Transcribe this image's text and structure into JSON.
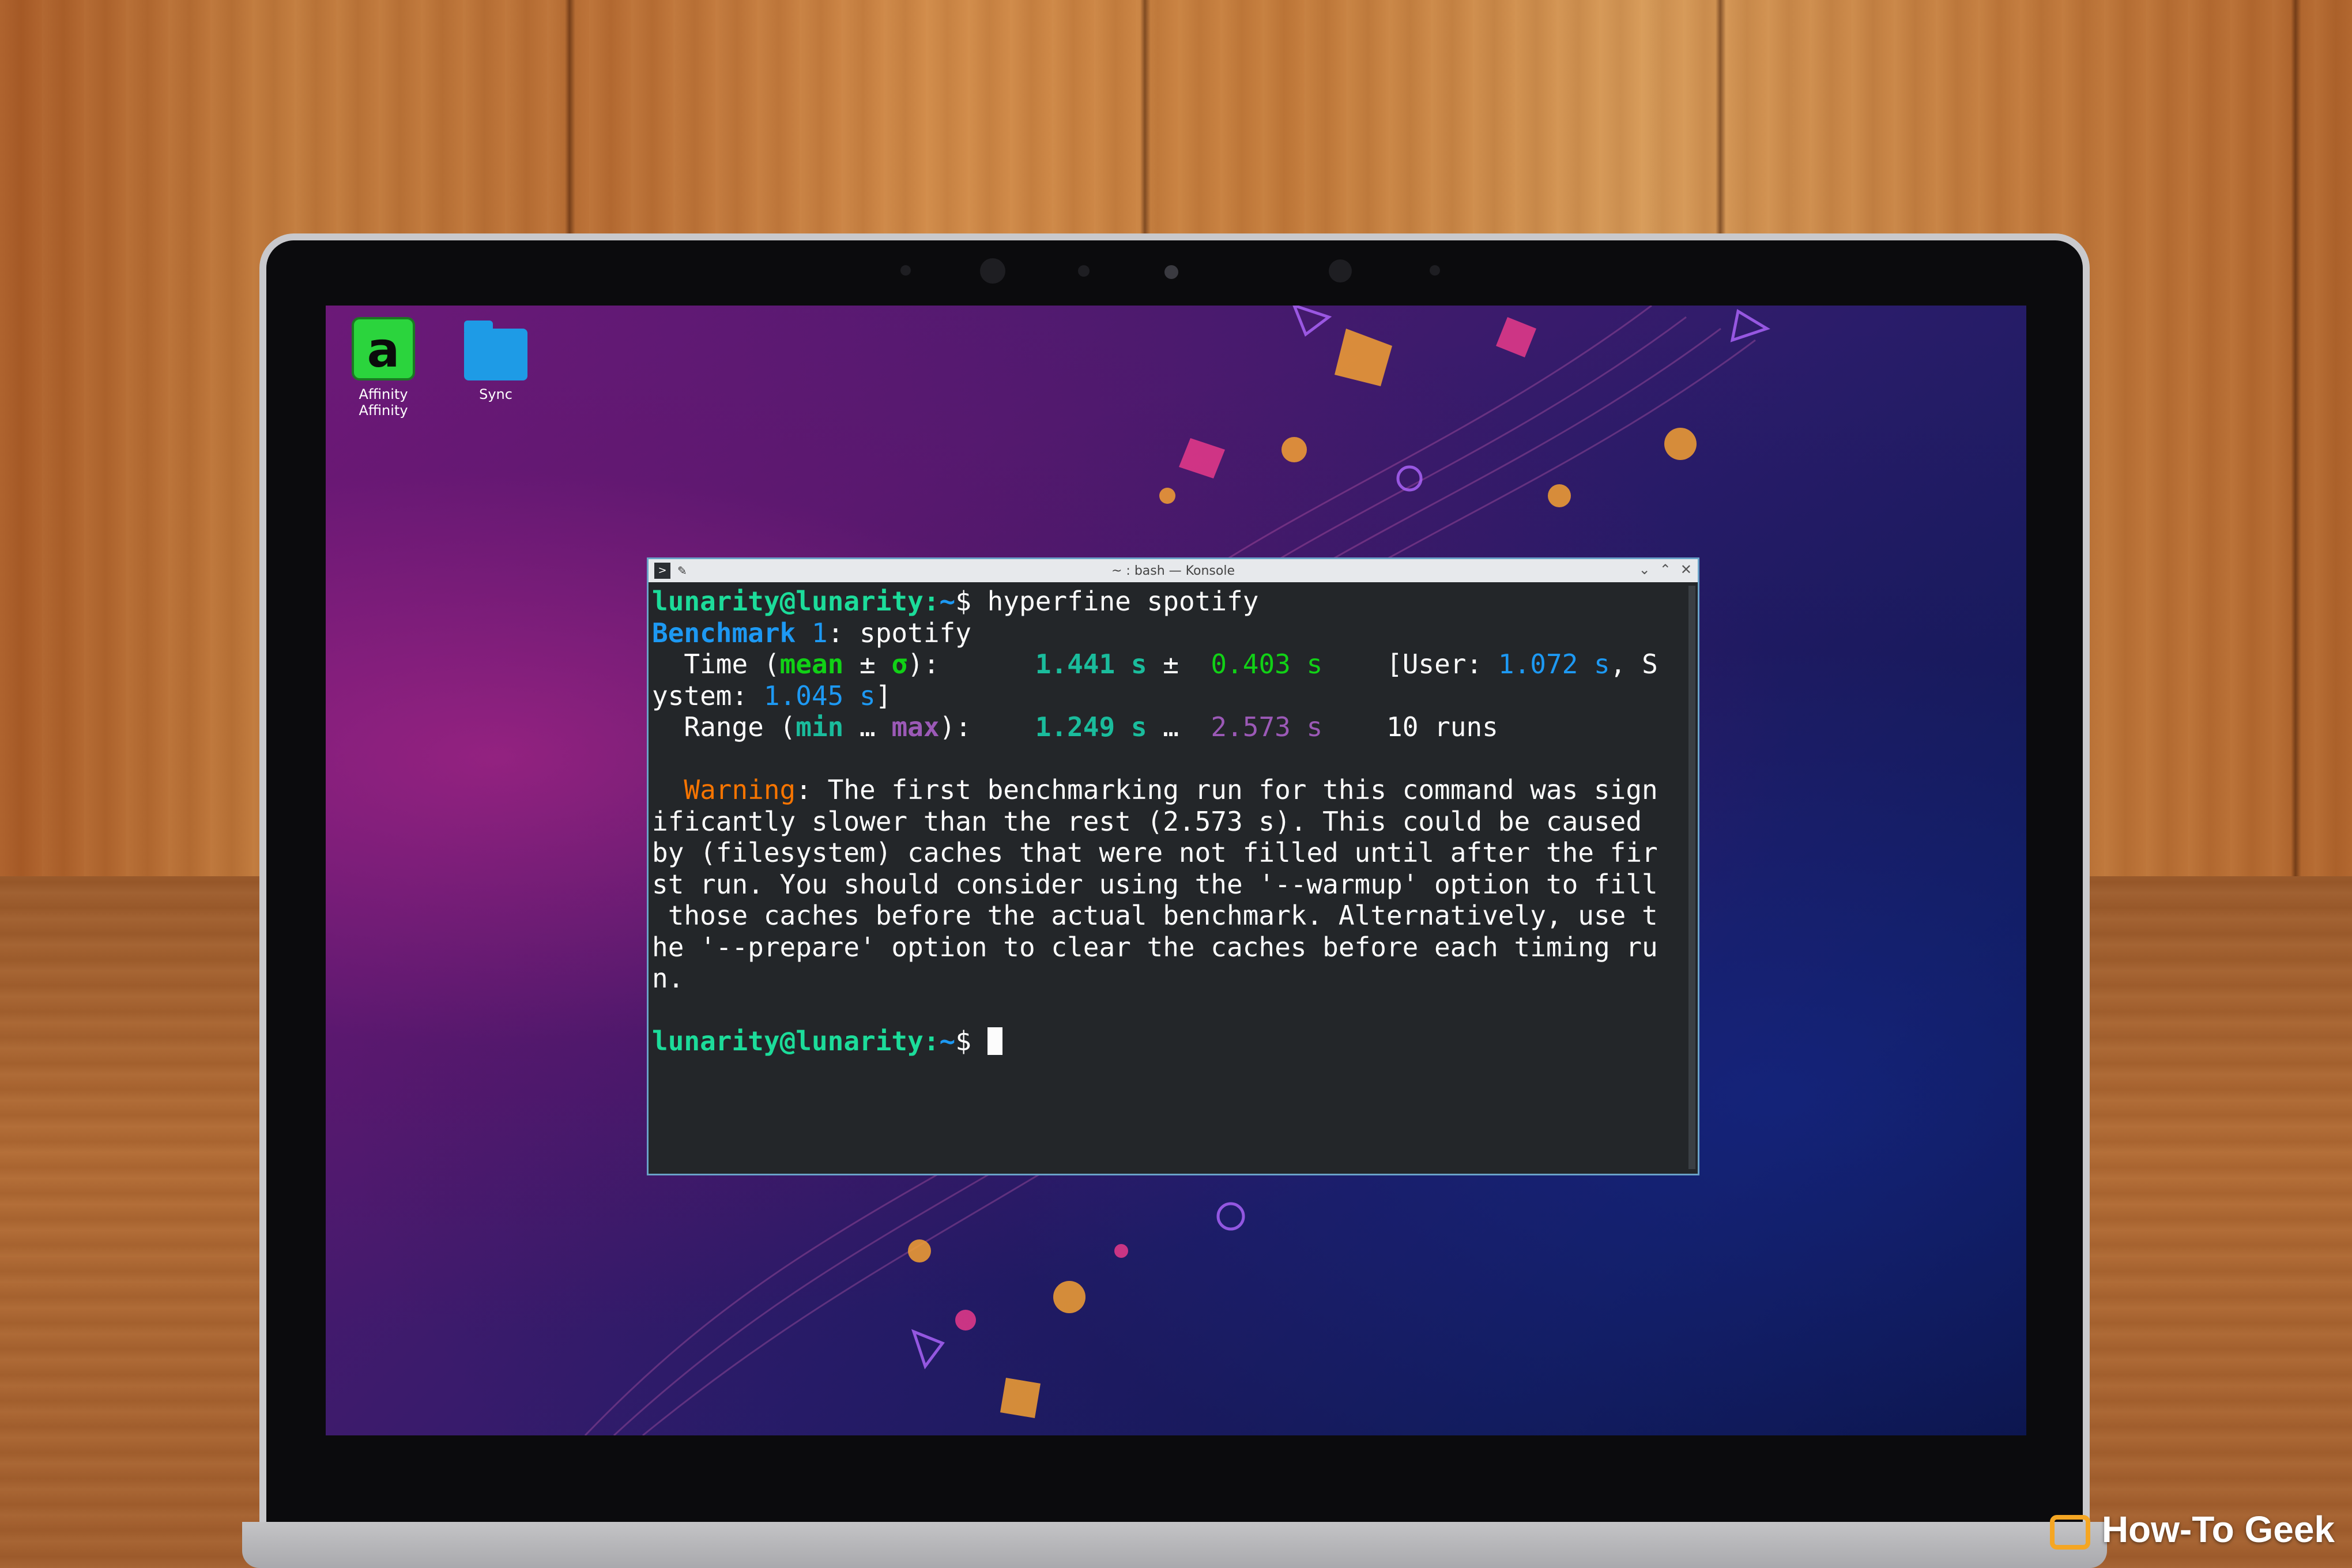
{
  "desktop": {
    "icons": [
      {
        "label": "Affinity Affinity",
        "glyph": "a"
      },
      {
        "label": "Sync"
      }
    ]
  },
  "konsole": {
    "title": "~ : bash — Konsole",
    "controls": {
      "minimize": "⌄",
      "maximize": "⌃",
      "close": "✕"
    },
    "prompt_user": "lunarity@lunarity",
    "prompt_path": "~",
    "prompt_symbol": "$",
    "command": " hyperfine spotify",
    "bench_label": "Benchmark ",
    "bench_num": "1",
    "bench_name": ": spotify",
    "time_label": "  Time (",
    "time_mean": "mean",
    "time_pm": " ± ",
    "time_sigma": "σ",
    "time_close": "):      ",
    "mean_val": "1.441 s",
    "pm2": " ±  ",
    "sigma_val": "0.403 s",
    "user_open": "    [User: ",
    "user_val": "1.072 s",
    "user_sep": ", S",
    "sys_label": "ystem: ",
    "sys_val": "1.045 s",
    "sys_close": "]",
    "range_label": "  Range (",
    "range_min": "min",
    "range_ell": " … ",
    "range_max": "max",
    "range_close": "):    ",
    "min_val": "1.249 s",
    "ell2": " …  ",
    "max_val": "2.573 s",
    "runs": "    10 runs",
    "warning_label": "  Warning",
    "warning_text": ": The first benchmarking run for this command was sign\nificantly slower than the rest (2.573 s). This could be caused\nby (filesystem) caches that were not filled until after the fir\nst run. You should consider using the '--warmup' option to fill\n those caches before the actual benchmark. Alternatively, use t\nhe '--prepare' option to clear the caches before each timing ru\nn."
  },
  "watermark": "How-To Geek",
  "colors": {
    "prompt_green": "#1cdc9a",
    "blue": "#1d99f3",
    "cyan": "#1abc9c",
    "green": "#11d116",
    "purple": "#9b59b6",
    "orange": "#f67400",
    "terminal_bg": "#232629"
  }
}
